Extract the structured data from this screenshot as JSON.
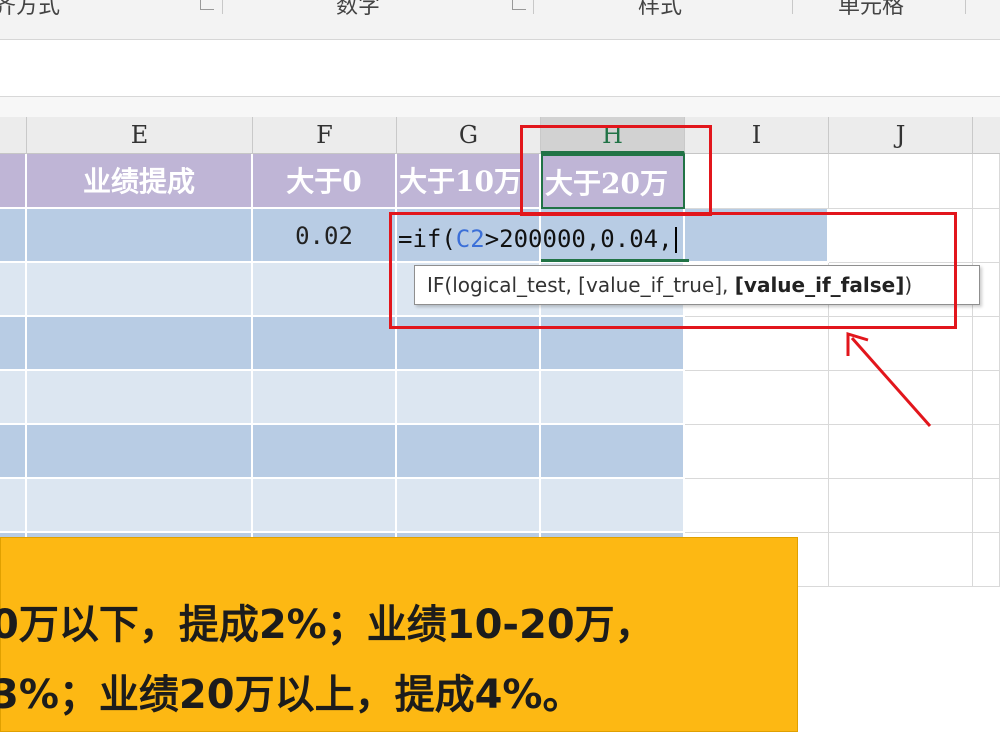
{
  "ribbon": {
    "groups": [
      "齐方式",
      "数字",
      "样式",
      "单元格"
    ]
  },
  "columns": {
    "headers": [
      "E",
      "F",
      "G",
      "H",
      "I",
      "J"
    ],
    "active": "H"
  },
  "header_row": {
    "e": "业绩提成",
    "f": "大于0",
    "g": "大于10万",
    "h": "大于20万"
  },
  "row2": {
    "f_value": "0.02"
  },
  "formula": {
    "prefix": "=if(",
    "ref": "C2",
    "rest": ">200000,0.04,"
  },
  "tooltip": {
    "text_normal": "IF(logical_test, [value_if_true], ",
    "text_bold": "[value_if_false]",
    "text_end": ")"
  },
  "note": {
    "line1": "0万以下，提成2%；业绩10-20万，",
    "line2": "3%；业绩20万以上，提成4%。"
  },
  "colors": {
    "header_purple": "#bfb5d6",
    "band_dark": "#b8cce4",
    "band_light": "#dce6f1",
    "annotation_red": "#e2161c",
    "note_orange": "#fdb813",
    "excel_green": "#217346"
  }
}
